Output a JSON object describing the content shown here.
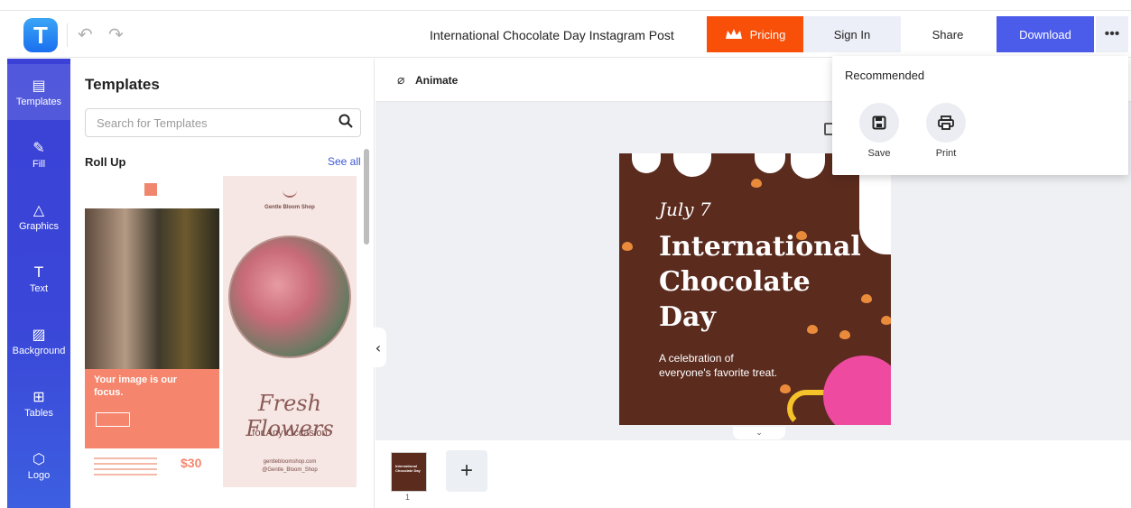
{
  "header": {
    "logo_letter": "T",
    "undo_glyph": "↶",
    "redo_glyph": "↷",
    "title": "International Chocolate Day Instagram Post",
    "pricing_label": "Pricing",
    "signin_label": "Sign In",
    "share_label": "Share",
    "download_label": "Download",
    "more_label": "•••"
  },
  "rail": {
    "items": [
      {
        "label": "Templates",
        "icon": "templates-icon",
        "glyph": "▤"
      },
      {
        "label": "Fill",
        "icon": "pencil-icon",
        "glyph": "✎"
      },
      {
        "label": "Graphics",
        "icon": "shapes-icon",
        "glyph": "△"
      },
      {
        "label": "Text",
        "icon": "text-icon",
        "glyph": "T"
      },
      {
        "label": "Background",
        "icon": "background-icon",
        "glyph": "▨"
      },
      {
        "label": "Tables",
        "icon": "table-icon",
        "glyph": "⊞"
      },
      {
        "label": "Logo",
        "icon": "logo-icon",
        "glyph": "⬡"
      }
    ]
  },
  "panel": {
    "title": "Templates",
    "search_placeholder": "Search for Templates",
    "section_title": "Roll Up",
    "see_all": "See all",
    "template1": {
      "headline": "Your image is our focus.",
      "price": "$30"
    },
    "template2": {
      "brand": "Gentle Bloom Shop",
      "script": "Fresh Flowers",
      "sub": "for Any Occasion",
      "contact_1": "gentlebloomshop.com",
      "contact_2": "@Gentle_Bloom_Shop"
    }
  },
  "toolbar": {
    "animate_label": "Animate",
    "animate_icon": "animate-icon"
  },
  "design": {
    "date": "July 7",
    "title": "International Chocolate Day",
    "subtitle": "A celebration of everyone's favorite treat."
  },
  "pages": {
    "thumb_text": "International Chocolate Day",
    "page_number": "1",
    "add_label": "+",
    "collapse_glyph": "⌄"
  },
  "dropdown": {
    "title": "Recommended",
    "save_label": "Save",
    "print_label": "Print"
  },
  "colors": {
    "brand_blue": "#4b5bea",
    "pricing_orange": "#f84f09",
    "chocolate": "#5b2b1e",
    "rail": "#3b41d6"
  }
}
